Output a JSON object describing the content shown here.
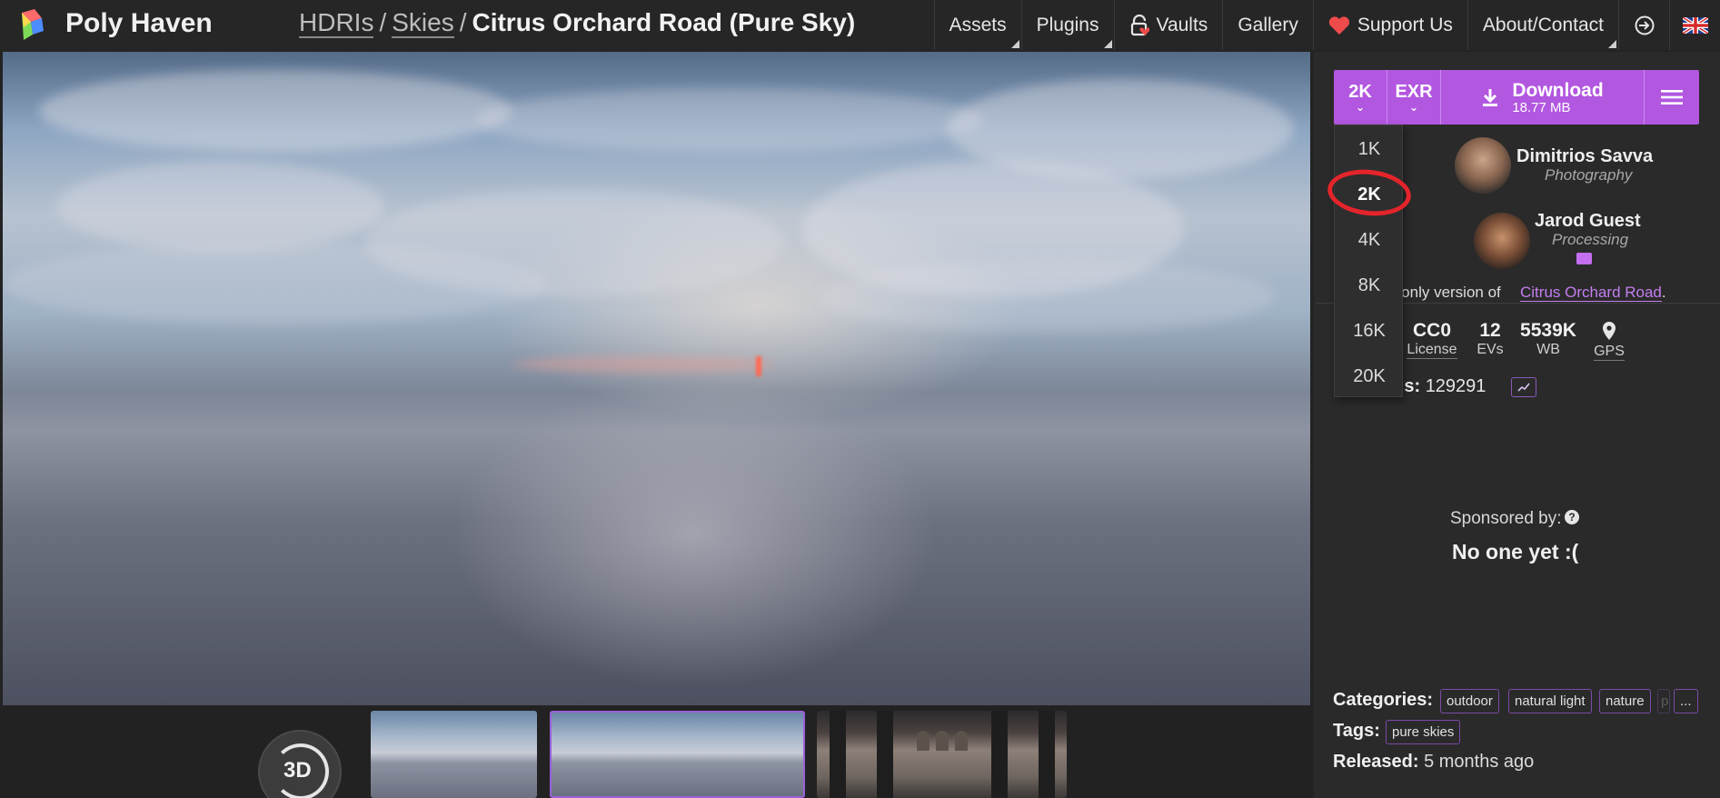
{
  "brand": {
    "name": "Poly Haven"
  },
  "breadcrumb": {
    "items": [
      "HDRIs",
      "Skies"
    ],
    "separator": "/",
    "current": "Citrus Orchard Road (Pure Sky)"
  },
  "nav": {
    "items": [
      "Assets",
      "Plugins",
      "Vaults",
      "Gallery",
      "Support Us",
      "About/Contact"
    ]
  },
  "download": {
    "resolution": "2K",
    "format": "EXR",
    "label": "Download",
    "size": "18.77 MB",
    "resolution_options": [
      "1K",
      "2K",
      "4K",
      "8K",
      "16K",
      "20K"
    ],
    "selected_option": "2K"
  },
  "authors": [
    {
      "name": "Dimitrios Savva",
      "role": "Photography"
    },
    {
      "name": "Jarod Guest",
      "role": "Processing"
    }
  ],
  "description": {
    "prefix": "y-only version of ",
    "link": "Citrus Orchard Road",
    "suffix": "."
  },
  "stats": [
    {
      "value": "CC0",
      "label": "License"
    },
    {
      "value": "12",
      "label": "EVs"
    },
    {
      "value": "5539K",
      "label": "WB"
    },
    {
      "value": "",
      "label": "GPS"
    }
  ],
  "downloads": {
    "label": "ads:",
    "count": "129291"
  },
  "sponsor": {
    "label": "Sponsored by:",
    "help": "?",
    "value": "No one yet :("
  },
  "categories": {
    "label": "Categories:",
    "items": [
      "outdoor",
      "natural light",
      "nature",
      "p",
      "..."
    ]
  },
  "tags": {
    "label": "Tags:",
    "items": [
      "pure skies"
    ]
  },
  "released": {
    "label": "Released:",
    "value": "5 months ago"
  },
  "viewer": {
    "btn_3d": "3D"
  },
  "colors": {
    "accent": "#b257e0",
    "annotation": "#e5242b",
    "background": "#232323"
  }
}
